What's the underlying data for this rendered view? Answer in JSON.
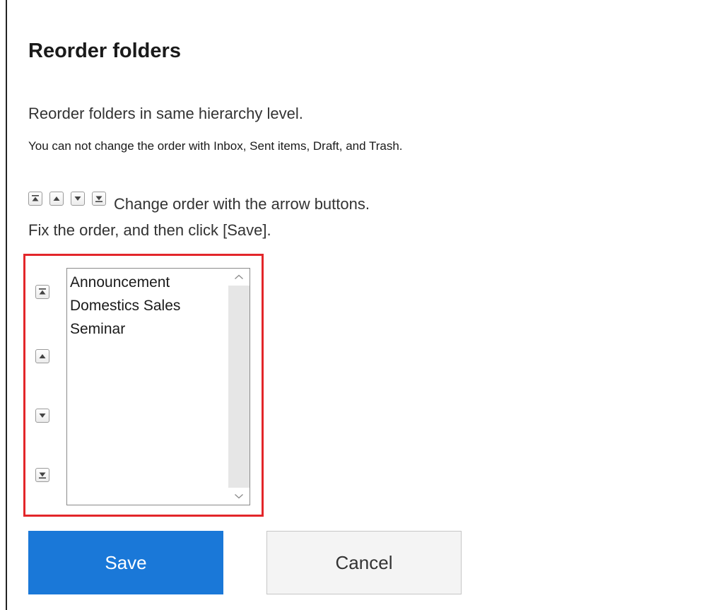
{
  "dialog": {
    "title": "Reorder folders",
    "description": "Reorder folders in same hierarchy level.",
    "note": "You can not change the order with Inbox, Sent items, Draft, and Trash.",
    "instruction_line1": "Change order with the arrow buttons.",
    "instruction_line2": "Fix the order, and then click [Save]."
  },
  "legend_icons": [
    "move-to-top-icon",
    "move-up-icon",
    "move-down-icon",
    "move-to-bottom-icon"
  ],
  "reorder_buttons": [
    "move-to-top",
    "move-up",
    "move-down",
    "move-to-bottom"
  ],
  "folders": {
    "items": [
      "Announcement",
      "Domestics Sales",
      "Seminar"
    ]
  },
  "buttons": {
    "save_label": "Save",
    "cancel_label": "Cancel"
  },
  "colors": {
    "primary": "#1a78d8",
    "highlight_border": "#e3262a",
    "cancel_background": "#f4f4f4"
  }
}
